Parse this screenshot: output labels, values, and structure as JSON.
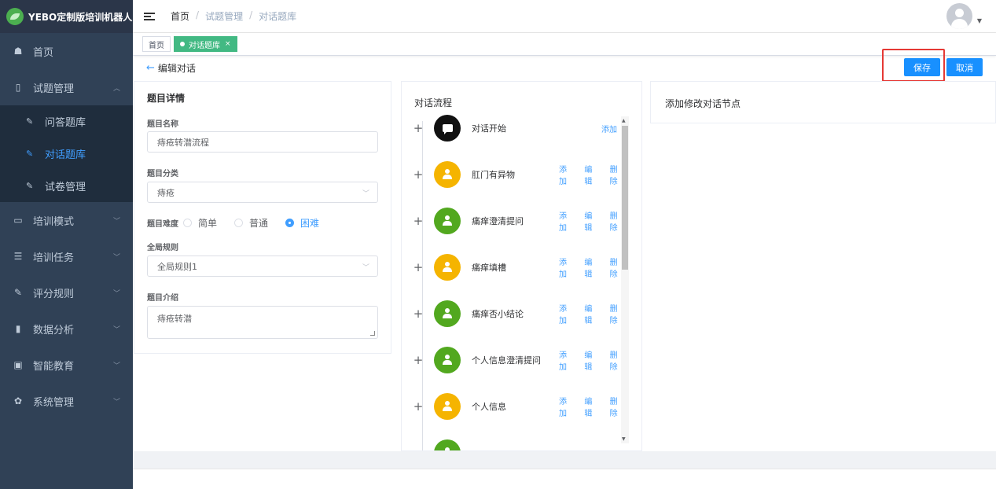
{
  "app": {
    "logo_text": "YEBO定制版培训机器人"
  },
  "sidebar": {
    "items": [
      {
        "label": "首页",
        "icon": "dashboard-icon",
        "glyph": "☗"
      },
      {
        "label": "试题管理",
        "icon": "book-icon",
        "glyph": "▯"
      },
      {
        "label": "培训模式",
        "icon": "monitor-icon",
        "glyph": "▭"
      },
      {
        "label": "培训任务",
        "icon": "list-icon",
        "glyph": "☰"
      },
      {
        "label": "评分规则",
        "icon": "edit-icon",
        "glyph": "✎"
      },
      {
        "label": "数据分析",
        "icon": "chart-icon",
        "glyph": "▮"
      },
      {
        "label": "智能教育",
        "icon": "screen-icon",
        "glyph": "▣"
      },
      {
        "label": "系统管理",
        "icon": "gear-icon",
        "glyph": "✿"
      }
    ],
    "sub_items": [
      {
        "label": "问答题库"
      },
      {
        "label": "对话题库"
      },
      {
        "label": "试卷管理"
      }
    ],
    "sub_glyph": "✎"
  },
  "header": {
    "breadcrumb": [
      "首页",
      "试题管理",
      "对话题库"
    ],
    "sep": "/"
  },
  "tags": [
    {
      "label": "首页"
    },
    {
      "label": "对话题库",
      "close": "×"
    }
  ],
  "page": {
    "back_arrow": "←",
    "title": "编辑对话",
    "save_label": "保存",
    "cancel_label": "取消"
  },
  "detail": {
    "title": "题目详情",
    "name_label": "题目名称",
    "name_value": "痔疮转潜流程",
    "category_label": "题目分类",
    "category_value": "痔疮",
    "difficulty_label": "题目难度",
    "difficulty_options": [
      "简单",
      "普通",
      "困难"
    ],
    "difficulty_selected": "困难",
    "rule_label": "全局规则",
    "rule_value": "全局规则1",
    "intro_label": "题目介绍",
    "intro_value": "痔疮转潜"
  },
  "flow": {
    "title": "对话流程",
    "add_label": "添加",
    "edit_label": "编辑",
    "delete_label": "删除",
    "nodes": [
      {
        "label": "对话开始",
        "color": "#111111",
        "icon": "chat-icon"
      },
      {
        "label": "肛门有异物",
        "color": "#f5b400",
        "icon": "user-icon"
      },
      {
        "label": "痛痒澄清提问",
        "color": "#52a81f",
        "icon": "user-icon"
      },
      {
        "label": "痛痒填槽",
        "color": "#f5b400",
        "icon": "user-icon"
      },
      {
        "label": "痛痒否小结论",
        "color": "#52a81f",
        "icon": "user-icon"
      },
      {
        "label": "个人信息澄清提问",
        "color": "#52a81f",
        "icon": "user-icon"
      },
      {
        "label": "个人信息",
        "color": "#f5b400",
        "icon": "user-icon"
      },
      {
        "label": "",
        "color": "#52a81f",
        "icon": "user-icon"
      }
    ]
  },
  "editor": {
    "title": "添加修改对话节点"
  },
  "colors": {
    "accent": "#409eff",
    "sidebar_bg": "#304156",
    "tag_active": "#42b983",
    "highlight": "#e53935"
  }
}
